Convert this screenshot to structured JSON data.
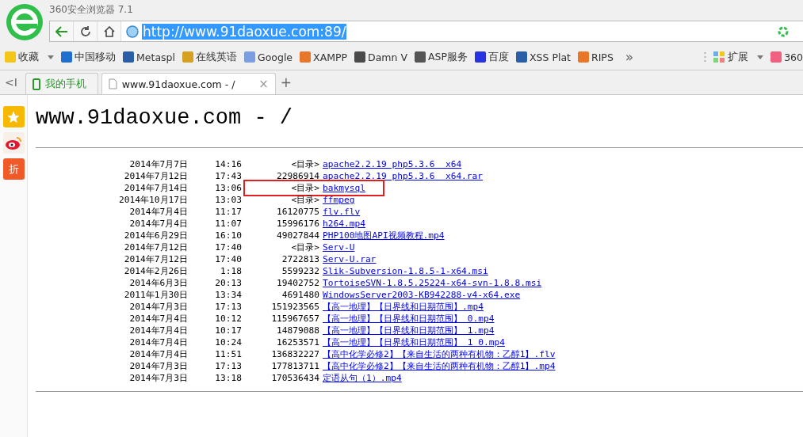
{
  "window": {
    "title": "360安全浏览器 7.1"
  },
  "address_bar": {
    "url": "http://www.91daoxue.com:89/",
    "url_selected": true
  },
  "bookmarks": [
    {
      "label": "收藏",
      "color": "#f5c518",
      "dropdown": true
    },
    {
      "label": "中国移动",
      "color": "#1e6fd0",
      "dropdown": false
    },
    {
      "label": "Metaspl",
      "color": "#2a5fa8",
      "dropdown": false
    },
    {
      "label": "在线英语",
      "color": "#d8a020",
      "dropdown": false
    },
    {
      "label": "Google",
      "color": "#7a9ee0",
      "dropdown": false
    },
    {
      "label": "XAMPP",
      "color": "#e8772a",
      "dropdown": false
    },
    {
      "label": "Damn V",
      "color": "#4a4a4a",
      "dropdown": false
    },
    {
      "label": "ASP服务",
      "color": "#555555",
      "dropdown": false
    },
    {
      "label": "百度",
      "color": "#2932e1",
      "dropdown": false
    },
    {
      "label": "XSS Plat",
      "color": "#2a5fa8",
      "dropdown": false
    },
    {
      "label": "RIPS",
      "color": "#e8772a",
      "dropdown": false
    }
  ],
  "bookmarks_more": "»",
  "extensions": {
    "label": "扩展",
    "dropdown": true
  },
  "extra_bookmark": {
    "label": "360",
    "color": "#f06080"
  },
  "tabs": [
    {
      "label": "我的手机",
      "kind": "pinned",
      "selected": false
    },
    {
      "label": "www.91daoxue.com - /",
      "kind": "page",
      "selected": true
    }
  ],
  "tab_close": "×",
  "new_tab": "+",
  "tab_scroll": "<I",
  "sidebar": [
    {
      "kind": "star"
    },
    {
      "kind": "weibo"
    },
    {
      "kind": "discount",
      "label": "折"
    }
  ],
  "page": {
    "heading": "www.91daoxue.com - /",
    "rows": [
      {
        "date": "2014年7月7日",
        "time": "14:16",
        "size": "<目录>",
        "name": "apache2.2.19 php5.3.6  x64",
        "highlighted": false
      },
      {
        "date": "2014年7月12日",
        "time": "17:43",
        "size": "22986914",
        "name": "apache2.2.19 php5.3.6  x64.rar",
        "highlighted": false
      },
      {
        "date": "2014年7月14日",
        "time": "13:06",
        "size": "<目录>",
        "name": "bakmysql",
        "highlighted": true
      },
      {
        "date": "2014年10月17日",
        "time": "13:03",
        "size": "<目录>",
        "name": "ffmpeg",
        "highlighted": false
      },
      {
        "date": "2014年7月4日",
        "time": "11:17",
        "size": "16120775",
        "name": "flv.flv",
        "highlighted": false
      },
      {
        "date": "2014年7月4日",
        "time": "11:07",
        "size": "15996176",
        "name": "h264.mp4",
        "highlighted": false
      },
      {
        "date": "2014年6月29日",
        "time": "16:10",
        "size": "49027844",
        "name": "PHP100地图API视频教程.mp4",
        "highlighted": false
      },
      {
        "date": "2014年7月12日",
        "time": "17:40",
        "size": "<目录>",
        "name": "Serv-U",
        "highlighted": false
      },
      {
        "date": "2014年7月12日",
        "time": "17:40",
        "size": "2722813",
        "name": "Serv-U.rar",
        "highlighted": false
      },
      {
        "date": "2014年2月26日",
        "time": "1:18",
        "size": "5599232",
        "name": "Slik-Subversion-1.8.5-1-x64.msi",
        "highlighted": false
      },
      {
        "date": "2014年6月3日",
        "time": "20:13",
        "size": "19402752",
        "name": "TortoiseSVN-1.8.5.25224-x64-svn-1.8.8.msi",
        "highlighted": false
      },
      {
        "date": "2011年1月30日",
        "time": "13:34",
        "size": "4691480",
        "name": "WindowsServer2003-KB942288-v4-x64.exe",
        "highlighted": false
      },
      {
        "date": "2014年7月3日",
        "time": "17:13",
        "size": "151923565",
        "name": "【高一地理】【日界线和日期范围】.mp4",
        "highlighted": false
      },
      {
        "date": "2014年7月4日",
        "time": "10:12",
        "size": "115967657",
        "name": "【高一地理】【日界线和日期范围】 0.mp4",
        "highlighted": false
      },
      {
        "date": "2014年7月4日",
        "time": "10:17",
        "size": "14879088",
        "name": "【高一地理】【日界线和日期范围】 1.mp4",
        "highlighted": false
      },
      {
        "date": "2014年7月4日",
        "time": "10:24",
        "size": "16253571",
        "name": "【高一地理】【日界线和日期范围】 1 0.mp4",
        "highlighted": false
      },
      {
        "date": "2014年7月4日",
        "time": "11:51",
        "size": "136832227",
        "name": "【高中化学必修2】【来自生活的两种有机物：乙醇1】.flv",
        "highlighted": false
      },
      {
        "date": "2014年7月3日",
        "time": "17:13",
        "size": "177813711",
        "name": "【高中化学必修2】【来自生活的两种有机物：乙醇1】.mp4",
        "highlighted": false
      },
      {
        "date": "2014年7月3日",
        "time": "13:18",
        "size": "170536434",
        "name": "定语从句（1）.mp4",
        "highlighted": false
      }
    ]
  }
}
